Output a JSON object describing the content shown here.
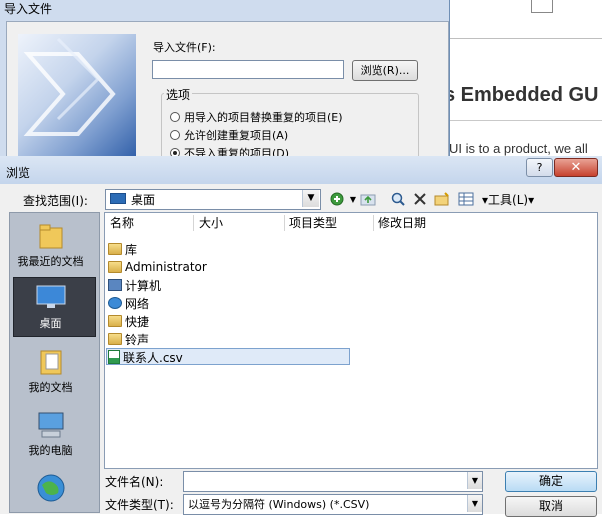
{
  "background_page": {
    "heading": "s Embedded GU",
    "text": "UI is to a product, we all"
  },
  "import_dialog": {
    "title": "导入文件",
    "file_label": "导入文件(F):",
    "file_value": "",
    "browse_label": "浏览(R)...",
    "options_title": "选项",
    "options": [
      {
        "label": "用导入的项目替换重复的项目(E)",
        "selected": false
      },
      {
        "label": "允许创建重复项目(A)",
        "selected": false
      },
      {
        "label": "不导入重复的项目(D)",
        "selected": true
      }
    ]
  },
  "browse_dialog": {
    "title": "浏览",
    "help_label": "?",
    "close_label": "✕",
    "look_in_label": "查找范围(I):",
    "look_in_value": "桌面",
    "tools_label": "▾工具(L)▾",
    "places": [
      {
        "label": "我最近的文档",
        "icon": "recent-folder-icon"
      },
      {
        "label": "桌面",
        "icon": "desktop-icon",
        "selected": true
      },
      {
        "label": "我的文档",
        "icon": "my-documents-icon"
      },
      {
        "label": "我的电脑",
        "icon": "my-computer-icon"
      },
      {
        "label": "",
        "icon": "network-globe-icon"
      }
    ],
    "columns": [
      "名称",
      "大小",
      "项目类型",
      "修改日期"
    ],
    "files": [
      {
        "name": "库",
        "icon": "library-icon"
      },
      {
        "name": "Administrator",
        "icon": "user-folder-icon"
      },
      {
        "name": "计算机",
        "icon": "computer-icon"
      },
      {
        "name": "网络",
        "icon": "network-icon"
      },
      {
        "name": "快捷",
        "icon": "folder-icon"
      },
      {
        "name": "铃声",
        "icon": "folder-icon"
      },
      {
        "name": "联系人.csv",
        "icon": "csv-file-icon",
        "selected": true
      }
    ],
    "file_name_label": "文件名(N):",
    "file_name_value": "",
    "file_type_label": "文件类型(T):",
    "file_type_value": "以逗号为分隔符 (Windows) (*.CSV)",
    "ok_label": "确定",
    "cancel_label": "取消"
  }
}
